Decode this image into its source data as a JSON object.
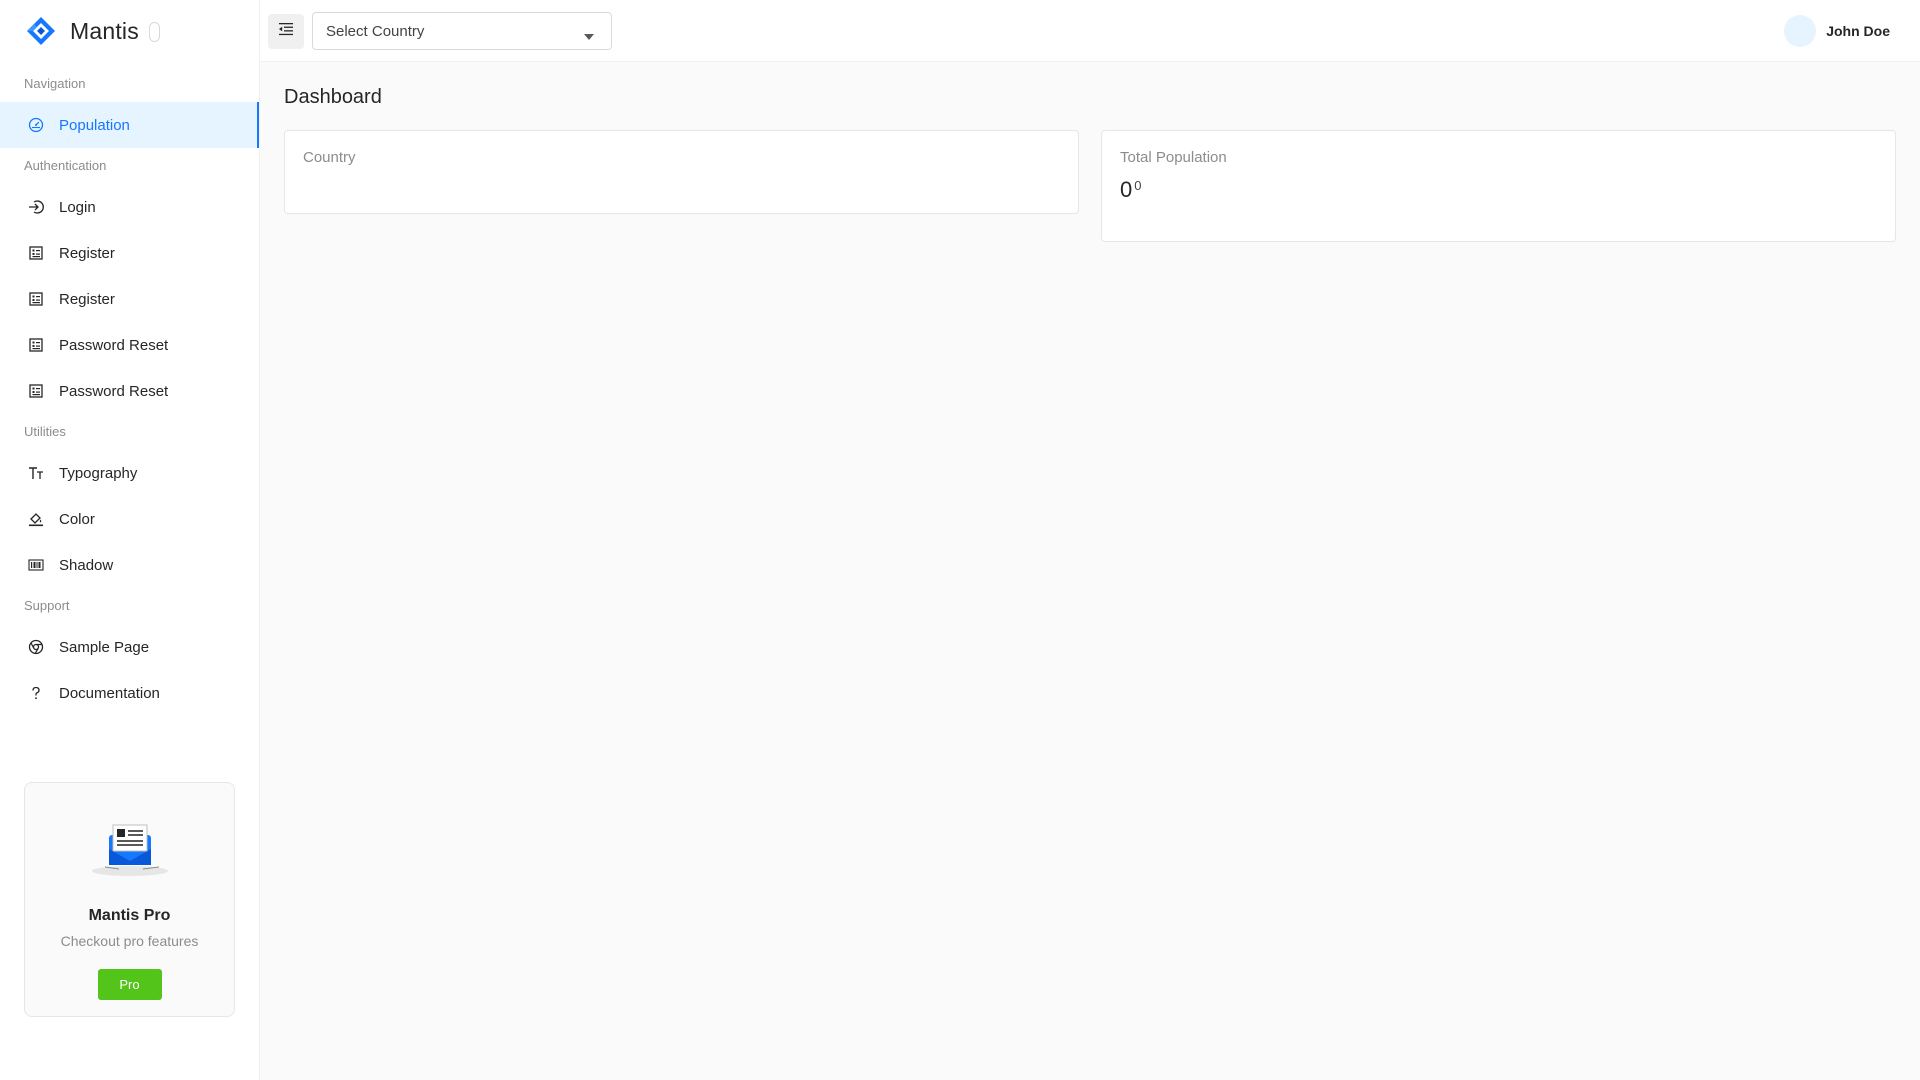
{
  "brand": {
    "name": "Mantis",
    "logo_icon": "mantis-logo-icon",
    "accent": "#1677ff"
  },
  "header": {
    "menu_toggle_icon": "menu-fold-icon",
    "country_select": {
      "value": "Select Country",
      "caret_icon": "caret-down-icon"
    },
    "user": {
      "name": "John Doe"
    }
  },
  "sidebar": {
    "groups": [
      {
        "caption": "Navigation",
        "items": [
          {
            "label": "Population",
            "icon": "dashboard-icon",
            "active": true
          }
        ]
      },
      {
        "caption": "Authentication",
        "items": [
          {
            "label": "Login",
            "icon": "login-icon"
          },
          {
            "label": "Register",
            "icon": "profile-icon"
          },
          {
            "label": "Register",
            "icon": "profile-icon"
          },
          {
            "label": "Password Reset",
            "icon": "profile-icon"
          },
          {
            "label": "Password Reset",
            "icon": "profile-icon"
          }
        ]
      },
      {
        "caption": "Utilities",
        "items": [
          {
            "label": "Typography",
            "icon": "font-size-icon"
          },
          {
            "label": "Color",
            "icon": "bg-colors-icon"
          },
          {
            "label": "Shadow",
            "icon": "barcode-icon"
          }
        ]
      },
      {
        "caption": "Support",
        "items": [
          {
            "label": "Sample Page",
            "icon": "chrome-icon"
          },
          {
            "label": "Documentation",
            "icon": "question-icon"
          }
        ]
      }
    ],
    "promo": {
      "title": "Mantis Pro",
      "subtitle": "Checkout pro features",
      "button": "Pro",
      "button_color": "#52c41a"
    }
  },
  "main": {
    "title": "Dashboard",
    "cards": {
      "country": {
        "label": "Country"
      },
      "population": {
        "label": "Total Population",
        "value": "0",
        "sup": "0"
      }
    }
  }
}
